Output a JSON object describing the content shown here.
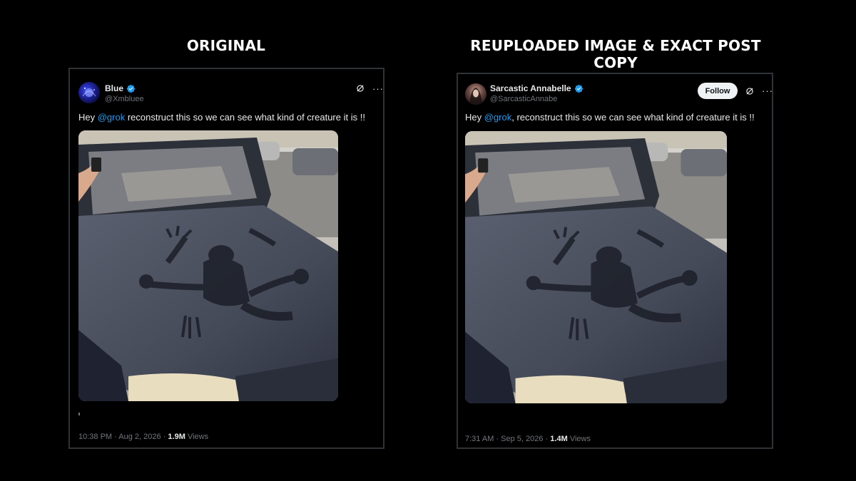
{
  "headings": {
    "left": "ORIGINAL",
    "right": "REUPLOADED IMAGE & EXACT POST COPY"
  },
  "posts": [
    {
      "display_name": "Blue",
      "handle": "@Xmbluee",
      "verified": true,
      "text_before": "Hey ",
      "mention": "@grok",
      "text_after": " reconstruct this so we can see what kind of creature it is !!",
      "time": "10:38 PM",
      "date": "Aug 2, 2026",
      "views_count": "1.9M",
      "views_label": "Views",
      "icons": [
        "grok-icon",
        "more-icon"
      ]
    },
    {
      "display_name": "Sarcastic Annabelle",
      "handle": "@SarcasticAnnabe",
      "verified": true,
      "follow_label": "Follow",
      "text_before": "Hey ",
      "mention": "@grok",
      "text_after": ", reconstruct this so we can see what kind of creature it is !!",
      "time": "7:31 AM",
      "date": "Sep 5, 2026",
      "views_count": "1.4M",
      "views_label": "Views",
      "icons": [
        "grok-icon",
        "more-icon"
      ]
    }
  ],
  "colors": {
    "background": "#000000",
    "border": "#2f3336",
    "mention": "#1d9bf0",
    "verified": "#1d9bf0",
    "secondary_text": "#71767b"
  }
}
